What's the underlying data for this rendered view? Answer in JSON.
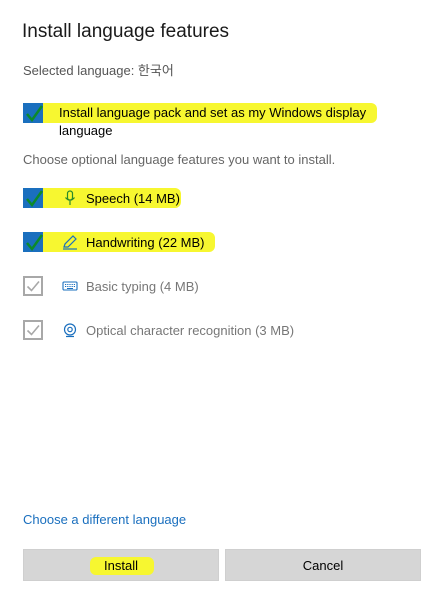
{
  "dialog": {
    "title": "Install language features",
    "selected_language": "Selected language: 한국어"
  },
  "main_option": {
    "label_line1": "Install language pack and set as my Windows display",
    "label_line2": "language",
    "checked": true
  },
  "optional_description": "Choose optional language features you want to install.",
  "features": [
    {
      "label": "Speech (14 MB)",
      "icon": "microphone-icon",
      "checked": true,
      "enabled": true
    },
    {
      "label": "Handwriting (22 MB)",
      "icon": "pen-icon",
      "checked": true,
      "enabled": true
    },
    {
      "label": "Basic typing (4 MB)",
      "icon": "keyboard-icon",
      "checked": true,
      "enabled": false
    },
    {
      "label": "Optical character recognition (3 MB)",
      "icon": "camera-icon",
      "checked": true,
      "enabled": false
    }
  ],
  "link_choose_language": "Choose a different language",
  "buttons": {
    "install": "Install",
    "cancel": "Cancel"
  },
  "colors": {
    "accent": "#1a6fbe",
    "highlight": "#f7f730",
    "check": "#0c8a2a",
    "button_bg": "#d6d6d6"
  }
}
